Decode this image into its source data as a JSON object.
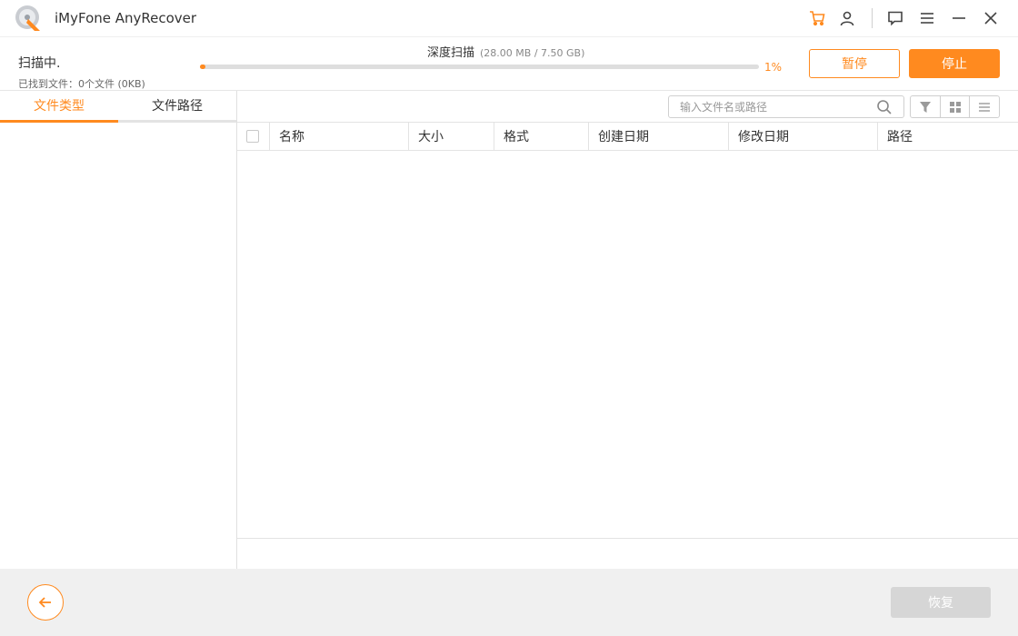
{
  "app": {
    "title": "iMyFone AnyRecover"
  },
  "titlebar_icons": [
    "cart-icon",
    "user-icon",
    "feedback-icon",
    "menu-icon",
    "minimize-icon",
    "close-icon"
  ],
  "colors": {
    "accent": "#ff8a1f",
    "disabled": "#d6d6d6"
  },
  "scan": {
    "state": "扫描中.",
    "found": "已找到文件：0个文件 (0KB)",
    "mode": "深度扫描",
    "size": "(28.00 MB / 7.50 GB)",
    "progress_percent": 1,
    "progress_label": "1%",
    "pause_label": "暂停",
    "stop_label": "停止"
  },
  "left_tabs": {
    "types": "文件类型",
    "paths": "文件路径",
    "active": "types"
  },
  "search": {
    "placeholder": "输入文件名或路径"
  },
  "view_buttons": [
    "filter-icon",
    "grid-view-icon",
    "list-view-icon"
  ],
  "table": {
    "columns": [
      "名称",
      "大小",
      "格式",
      "创建日期",
      "修改日期",
      "路径"
    ],
    "rows": []
  },
  "bottom": {
    "restore_label": "恢复"
  }
}
